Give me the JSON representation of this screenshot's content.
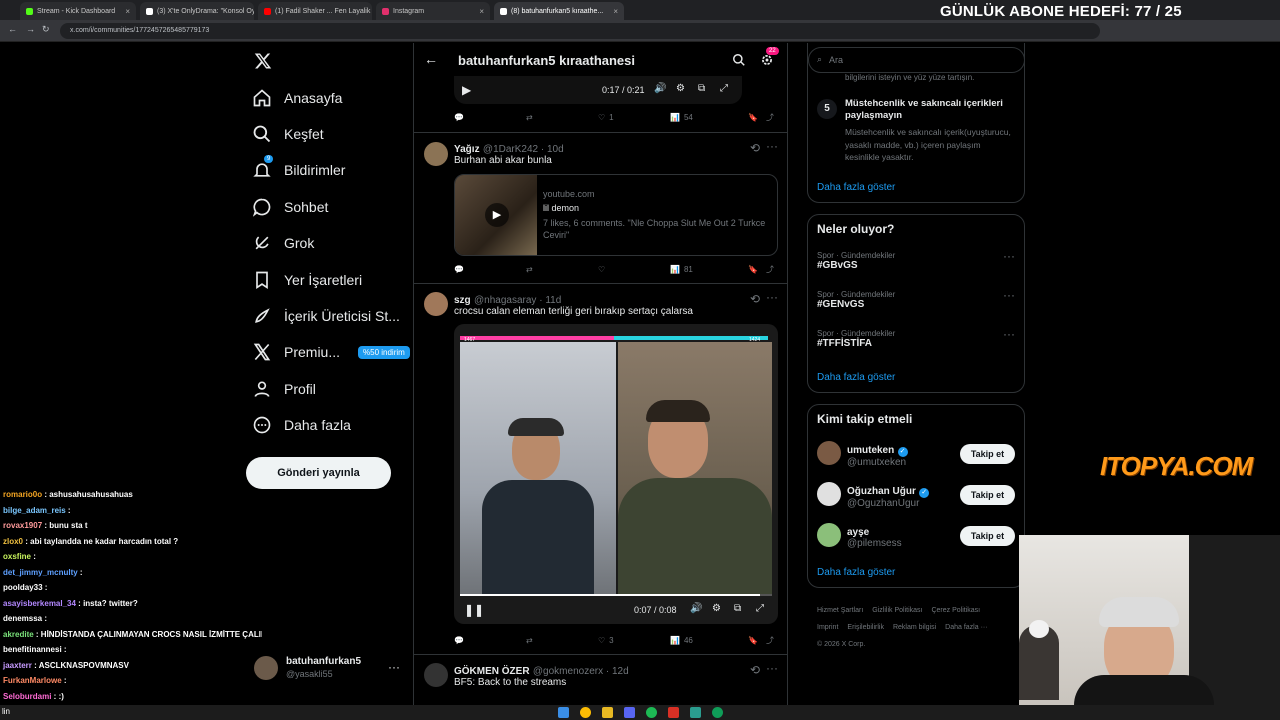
{
  "browser": {
    "tabs": [
      {
        "label": "Stream - Kick Dashboard",
        "color": "#53fc18"
      },
      {
        "label": "(3) X'te OnlyDrama: \"Konsol Oy...",
        "color": "#ffffff"
      },
      {
        "label": "(1) Fadil Shaker ... Fen Layalik | ...",
        "color": "#ff0000"
      },
      {
        "label": "Instagram",
        "color": "#e1306c"
      },
      {
        "label": "(8) batuhanfurkan5 kıraathe...",
        "color": "#ffffff"
      }
    ],
    "url": "x.com/i/communities/1772457265485779173"
  },
  "stream_goal": "GÜNLÜK ABONE HEDEFİ: 77 / 25",
  "nav": {
    "items": [
      "Anasayfa",
      "Keşfet",
      "Bildirimler",
      "Sohbet",
      "Grok",
      "Yer İşaretleri",
      "İçerik Üreticisi St...",
      "Premiu...",
      "Profil",
      "Daha fazla"
    ],
    "premium_badge": "%50 indirim",
    "notif_badge": "9",
    "post_button": "Gönderi yayınla"
  },
  "account": {
    "name": "batuhanfurkan5",
    "handle": "@yasakli55"
  },
  "chat": [
    {
      "user": "romario0o",
      "text": "ashusahusahusahuas",
      "color": "#f5a623"
    },
    {
      "user": "bilge_adam_reis",
      "text": "",
      "color": "#7ac7ff"
    },
    {
      "user": "rovax1907",
      "text": "bunu sta t",
      "color": "#ff9b9b"
    },
    {
      "user": "zlox0",
      "text": "abi taylandda ne kadar harcadın total ?",
      "color": "#f0c040"
    },
    {
      "user": "oxsfine",
      "text": "",
      "color": "#c9f55e"
    },
    {
      "user": "det_jimmy_mcnulty",
      "text": "",
      "color": "#5ea0ff"
    },
    {
      "user": "poolday33",
      "text": "",
      "color": "#ffffff"
    },
    {
      "user": "asayisberkemal_34",
      "text": "insta? twitter?",
      "color": "#b388ff"
    },
    {
      "user": "denemssa",
      "text": "",
      "color": "#ffffff"
    },
    {
      "user": "akredite",
      "text": "HİNDİSTANDA ÇALINMAYAN CROCS NASIL İZMİTTE ÇALINDI",
      "color": "#7be37b"
    },
    {
      "user": "benefitinannesi",
      "text": "",
      "color": "#ffffff"
    },
    {
      "user": "jaaxterr",
      "text": "ASCLKNASPOVMNASV",
      "color": "#c79bff"
    },
    {
      "user": "FurkanMarlowe",
      "text": "",
      "color": "#ff8a65"
    },
    {
      "user": "Seloburdami",
      "text": ":)",
      "color": "#ff6bd5"
    }
  ],
  "timeline": {
    "title": "batuhanfurkan5 kıraathanesi",
    "settings_badge": "22",
    "top_video": {
      "time": "0:17 / 0:21",
      "likes": "1",
      "views": "54"
    },
    "posts": [
      {
        "name": "Yağız",
        "handle": "@1DarK242 · 10d",
        "text": "Burhan abi akar bunla",
        "card": {
          "domain": "youtube.com",
          "title": "lil demon",
          "desc": "7 likes, 6 comments. \"Nle Choppa Slut Me Out 2 Turkce Ceviri\""
        },
        "views": "81"
      },
      {
        "name": "szg",
        "handle": "@nhagasaray · 11d",
        "text": "crocsu calan eleman terliği geri bırakıp sertaçı çalarsa",
        "video": {
          "time": "0:07 / 0:08",
          "left_score": "1467",
          "right_score": "1424"
        },
        "likes": "3",
        "views": "46"
      },
      {
        "name": "GÖKMEN ÖZER",
        "handle": "@gokmenozerx · 12d",
        "text": "BF5: Back to the streams"
      }
    ]
  },
  "right": {
    "search_placeholder": "Ara",
    "rule_top": "bilgilerini isteyin ve yüz yüze tartışın.",
    "rule": {
      "num": "5",
      "title": "Müstehcenlik ve sakıncalı içerikleri paylaşmayın",
      "desc": "Müstehcenlik ve sakıncalı içerik(uyuşturucu, yasaklı madde, vb.) içeren paylaşım kesinlikle yasaktır."
    },
    "show_more": "Daha fazla göster",
    "trends_title": "Neler oluyor?",
    "trends": [
      {
        "meta": "Spor · Gündemdekiler",
        "tag": "#GBvGS"
      },
      {
        "meta": "Spor · Gündemdekiler",
        "tag": "#GENvGS"
      },
      {
        "meta": "Spor · Gündemdekiler",
        "tag": "#TFFİSTİFA"
      }
    ],
    "who_title": "Kimi takip etmeli",
    "who": [
      {
        "name": "umuteken",
        "handle": "@umutxeken",
        "verified": true
      },
      {
        "name": "Oğuzhan Uğur",
        "handle": "@OguzhanUgur",
        "verified": true
      },
      {
        "name": "ayşe",
        "handle": "@pilemsess",
        "verified": false
      }
    ],
    "follow_label": "Takip et",
    "footer": [
      "Hizmet Şartları",
      "Gizlilik Politikası",
      "Çerez Politikası",
      "Imprint",
      "Erişilebilirlik",
      "Reklam bilgisi",
      "Daha fazla ···",
      "© 2026 X Corp."
    ]
  },
  "overlay_logo": "ITOPYA.COM",
  "taskbar_text": "lin"
}
